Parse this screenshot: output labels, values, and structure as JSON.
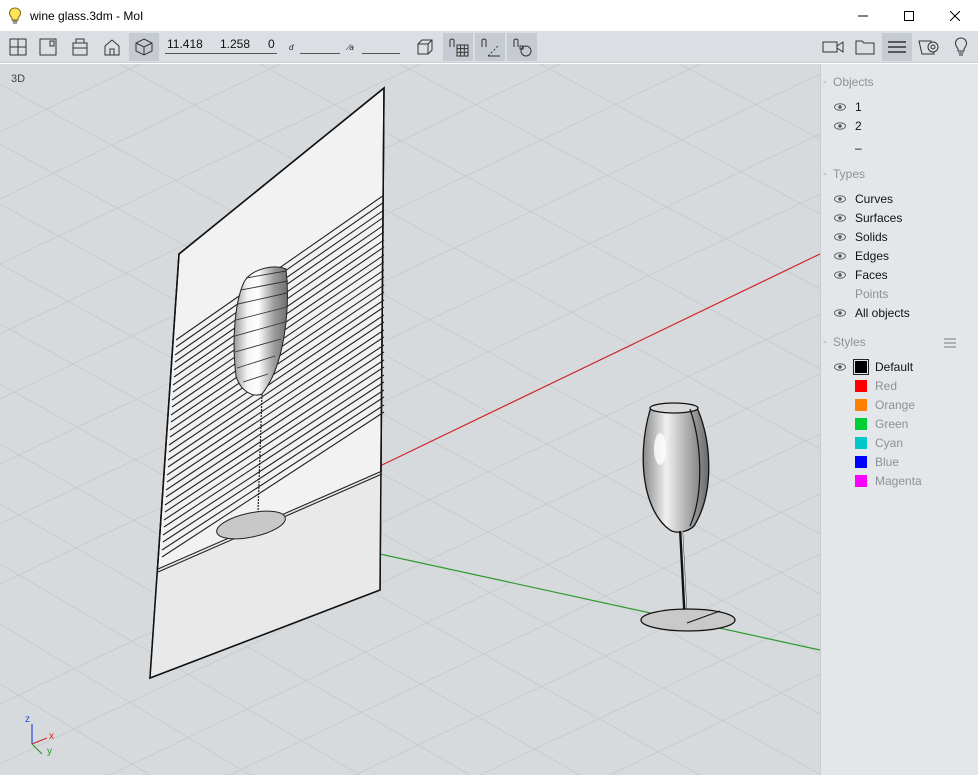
{
  "window": {
    "title": "wine glass.3dm - MoI",
    "icons": [
      "lightbulb-icon",
      "minimize-icon",
      "maximize-icon",
      "close-icon"
    ]
  },
  "toolbar": {
    "coord_x": "11.418",
    "coord_y": "1.258",
    "coord_z": "0",
    "distance_label": "d",
    "angle_label": "∕a",
    "left_icons": [
      "four-view-icon",
      "front-view-icon",
      "top-view-icon",
      "right-view-icon",
      "perspective-view-icon"
    ],
    "right_icons": [
      "camera-icon",
      "folder-icon",
      "menu-icon",
      "view-options-icon",
      "help-icon"
    ]
  },
  "viewport": {
    "label": "3D",
    "axes": {
      "x": "x",
      "y": "y",
      "z": "z"
    },
    "colors": {
      "x_axis": "#d0262b",
      "y_axis": "#2c9a2c",
      "background": "#d6dadd"
    }
  },
  "panel": {
    "objects": {
      "title": "Objects",
      "items": [
        {
          "label": "1",
          "visible": true
        },
        {
          "label": "2",
          "visible": true
        },
        {
          "label": "–",
          "visible": false
        }
      ]
    },
    "types": {
      "title": "Types",
      "items": [
        {
          "label": "Curves",
          "visible": true
        },
        {
          "label": "Surfaces",
          "visible": true
        },
        {
          "label": "Solids",
          "visible": true
        },
        {
          "label": "Edges",
          "visible": true
        },
        {
          "label": "Faces",
          "visible": true
        },
        {
          "label": "Points",
          "visible": false
        },
        {
          "label": "All objects",
          "visible": true
        }
      ]
    },
    "styles": {
      "title": "Styles",
      "items": [
        {
          "label": "Default",
          "color": "#000000",
          "visible": true,
          "selected": true
        },
        {
          "label": "Red",
          "color": "#ff0000",
          "visible": false
        },
        {
          "label": "Orange",
          "color": "#ff8000",
          "visible": false
        },
        {
          "label": "Green",
          "color": "#00cc33",
          "visible": false
        },
        {
          "label": "Cyan",
          "color": "#00c8c8",
          "visible": false
        },
        {
          "label": "Blue",
          "color": "#0000ff",
          "visible": false
        },
        {
          "label": "Magenta",
          "color": "#ff00ff",
          "visible": false
        }
      ]
    }
  }
}
